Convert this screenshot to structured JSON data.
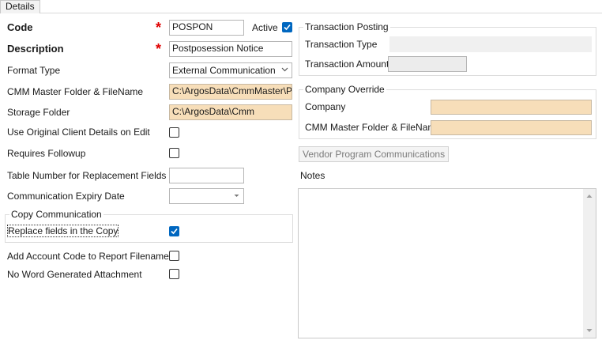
{
  "tabs": [
    {
      "label": "Details"
    }
  ],
  "form": {
    "code": {
      "label": "Code",
      "value": "POSPON"
    },
    "active": {
      "label": "Active",
      "checked": true
    },
    "description": {
      "label": "Description",
      "value": "Postposession Notice"
    },
    "format_type": {
      "label": "Format Type",
      "value": "External Communication"
    },
    "cmm_master": {
      "label": "CMM Master Folder & FileName",
      "value": "C:\\ArgosData\\CmmMaster\\Post"
    },
    "storage_folder": {
      "label": "Storage Folder",
      "value": "C:\\ArgosData\\Cmm"
    },
    "use_original": {
      "label": "Use Original Client Details on Edit",
      "checked": false
    },
    "requires_followup": {
      "label": "Requires Followup",
      "checked": false
    },
    "table_number": {
      "label": "Table Number for Replacement Fields",
      "value": ""
    },
    "expiry_date": {
      "label": "Communication Expiry Date",
      "value": ""
    },
    "copy_group": {
      "title": "Copy Communication",
      "replace_label": "Replace fields in the Copy",
      "checked": true
    },
    "add_account_code": {
      "label": "Add Account Code to Report Filenames",
      "checked": false
    },
    "no_word": {
      "label": "No Word Generated Attachment",
      "checked": false
    }
  },
  "transaction_posting": {
    "title": "Transaction Posting",
    "type_label": "Transaction Type",
    "type_value": "",
    "amount_label": "Transaction Amount",
    "amount_value": ""
  },
  "company_override": {
    "title": "Company Override",
    "company_label": "Company",
    "company_value": "",
    "cmm_label": "CMM Master Folder & FileName",
    "cmm_value": ""
  },
  "vendor_button": {
    "label": "Vendor Program Communications"
  },
  "notes": {
    "label": "Notes",
    "value": ""
  },
  "colors": {
    "required": "#e00000",
    "checkbox_on": "#0067c0",
    "readonly_tan": "#f7deb9"
  }
}
